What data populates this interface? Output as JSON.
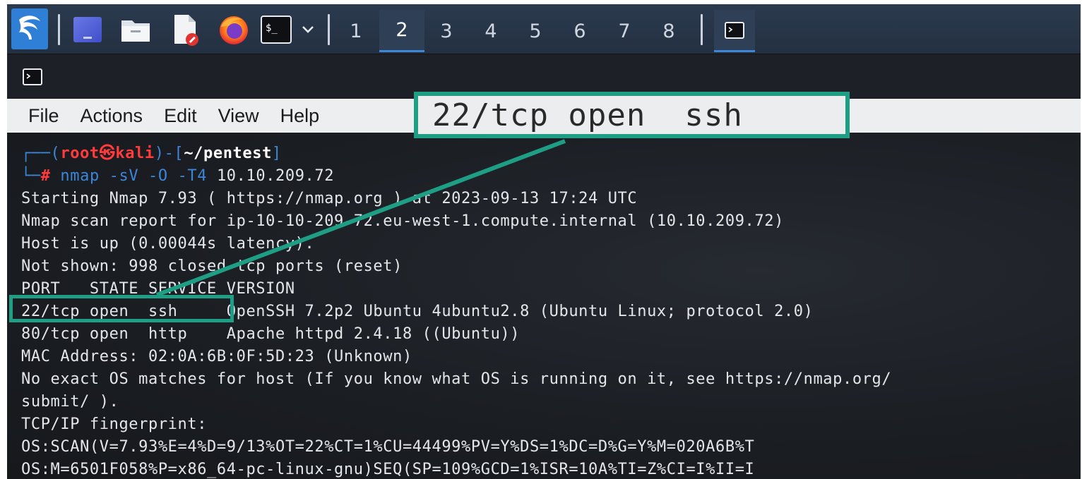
{
  "taskbar": {
    "workspaces": [
      "1",
      "2",
      "3",
      "4",
      "5",
      "6",
      "7",
      "8"
    ],
    "active_workspace": "2",
    "terminal_icon_text": "$_",
    "icons": [
      "kali-dragon-icon",
      "desktop-icon",
      "folder-icon",
      "text-editor-icon",
      "firefox-icon",
      "terminal-icon",
      "chevron-down-icon",
      "terminal-task-icon"
    ]
  },
  "window": {
    "menu": [
      "File",
      "Actions",
      "Edit",
      "View",
      "Help"
    ]
  },
  "terminal": {
    "prompt": {
      "box_top": "┌──(",
      "user": "root㉿kali",
      "mid": ")-[",
      "path": "~/pentest",
      "end": "]",
      "box_bottom": "└─",
      "hash": "#",
      "command": "nmap",
      "args": " -sV -O -T4",
      "target": " 10.10.209.72"
    },
    "lines": [
      "Starting Nmap 7.93 ( https://nmap.org ) at 2023-09-13 17:24 UTC",
      "Nmap scan report for ip-10-10-209-72.eu-west-1.compute.internal (10.10.209.72)",
      "Host is up (0.00044s latency).",
      "Not shown: 998 closed tcp ports (reset)",
      "PORT   STATE SERVICE VERSION",
      "22/tcp open  ssh     OpenSSH 7.2p2 Ubuntu 4ubuntu2.8 (Ubuntu Linux; protocol 2.0)",
      "80/tcp open  http    Apache httpd 2.4.18 ((Ubuntu))",
      "MAC Address: 02:0A:6B:0F:5D:23 (Unknown)",
      "No exact OS matches for host (If you know what OS is running on it, see https://nmap.org/",
      "submit/ ).",
      "TCP/IP fingerprint:",
      "OS:SCAN(V=7.93%E=4%D=9/13%OT=22%CT=1%CU=44499%PV=Y%DS=1%DC=D%G=Y%M=020A6B%T",
      "OS:M=6501F058%P=x86_64-pc-linux-gnu)SEQ(SP=109%GCD=1%ISR=10A%TI=Z%CI=I%II=I"
    ]
  },
  "annotation": {
    "callout_text": "22/tcp open  ssh",
    "color": "#1e9e84"
  }
}
